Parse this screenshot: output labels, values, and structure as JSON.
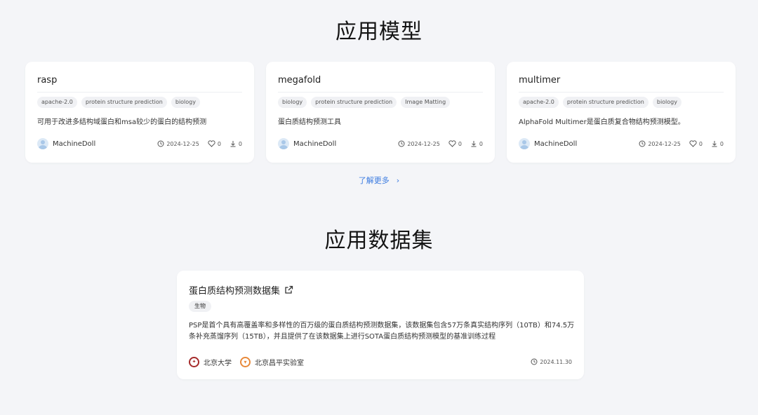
{
  "sections": {
    "models_title": "应用模型",
    "datasets_title": "应用数据集",
    "more_link": "了解更多"
  },
  "models": [
    {
      "name": "rasp",
      "tags": [
        "apache-2.0",
        "protein structure prediction",
        "biology"
      ],
      "description": "可用于改进多结构域蛋白和msa较少的蛋白的结构预测",
      "author": "MachineDoll",
      "date": "2024-12-25",
      "likes": "0",
      "downloads": "0"
    },
    {
      "name": "megafold",
      "tags": [
        "biology",
        "protein structure prediction",
        "Image Matting"
      ],
      "description": "蛋白质结构预测工具",
      "author": "MachineDoll",
      "date": "2024-12-25",
      "likes": "0",
      "downloads": "0"
    },
    {
      "name": "multimer",
      "tags": [
        "apache-2.0",
        "protein structure prediction",
        "biology"
      ],
      "description": "AlphaFold Multimer是蛋白质复合物结构预测模型。",
      "author": "MachineDoll",
      "date": "2024-12-25",
      "likes": "0",
      "downloads": "0"
    }
  ],
  "dataset": {
    "title": "蛋白质结构预测数据集",
    "tag": "生物",
    "description": "PSP是首个具有高覆盖率和多样性的百万级的蛋白质结构预测数据集，该数据集包含57万条真实结构序列（10TB）和74.5万条补充蒸馏序列（15TB），并且提供了在该数据集上进行SOTA蛋白质结构预测模型的基准训练过程",
    "orgs": [
      "北京大学",
      "北京昌平实验室"
    ],
    "date": "2024.11.30"
  },
  "colors": {
    "background": "#f4f5f8",
    "card": "#ffffff",
    "link": "#3b7be0",
    "pku_red": "#a52a2a",
    "cp_orange": "#e8893a"
  },
  "icons": [
    "clock-icon",
    "heart-icon",
    "download-icon",
    "external-link-icon",
    "chevron-right-icon"
  ]
}
